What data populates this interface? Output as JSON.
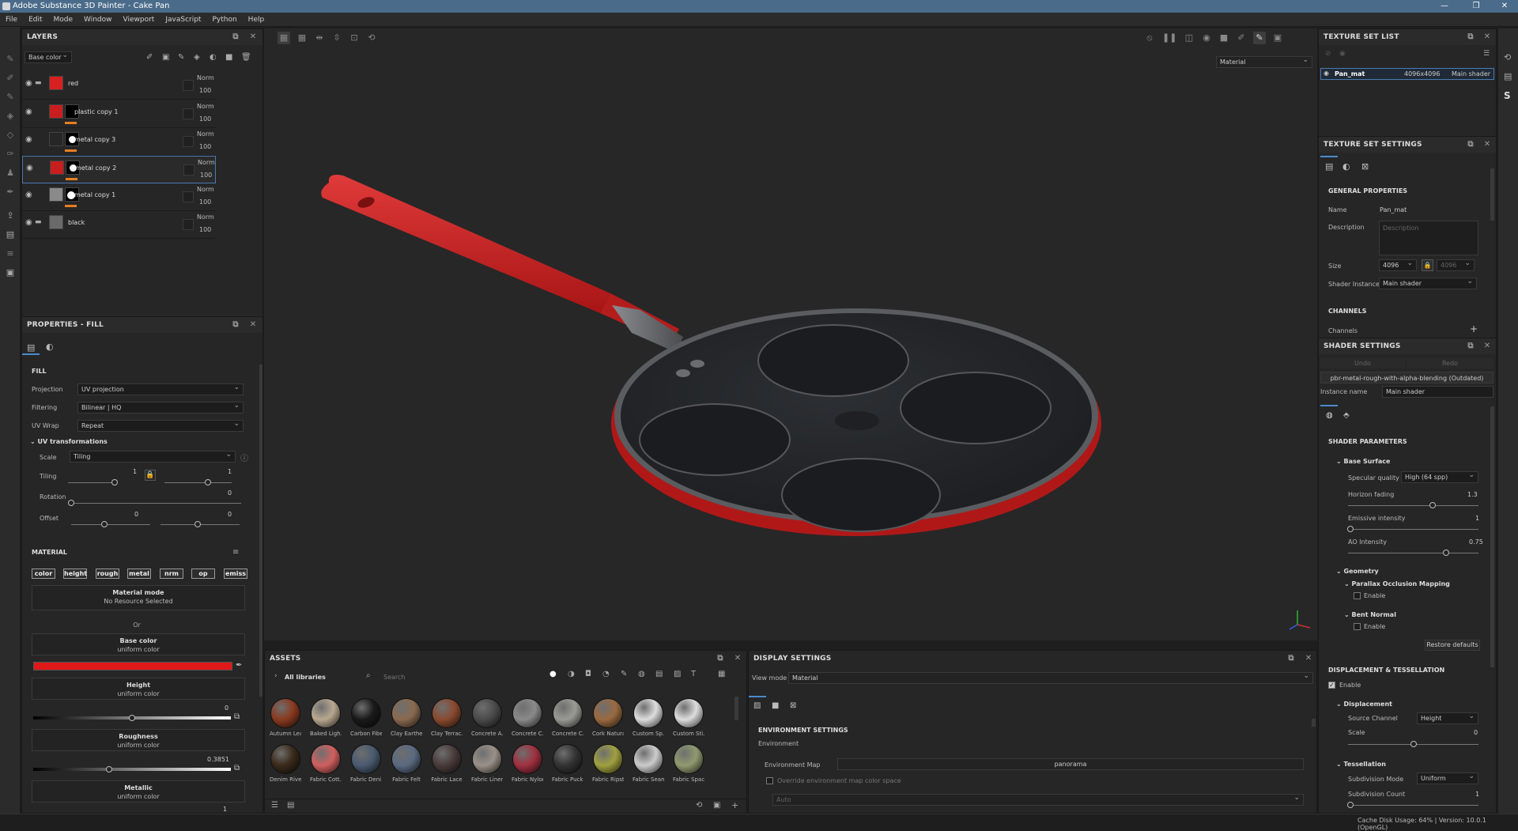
{
  "window": {
    "title": "Adobe Substance 3D Painter - Cake Pan"
  },
  "menu": [
    "File",
    "Edit",
    "Mode",
    "Window",
    "Viewport",
    "JavaScript",
    "Python",
    "Help"
  ],
  "layers": {
    "title": "LAYERS",
    "channel": "Base color",
    "items": [
      {
        "name": "red",
        "blend": "Norm",
        "opacity": "100"
      },
      {
        "name": "plastic copy 1",
        "blend": "Norm",
        "opacity": "100"
      },
      {
        "name": "metal copy 3",
        "blend": "Norm",
        "opacity": "100"
      },
      {
        "name": "metal copy 2",
        "blend": "Norm",
        "opacity": "100"
      },
      {
        "name": "metal copy 1",
        "blend": "Norm",
        "opacity": "100"
      },
      {
        "name": "black",
        "blend": "Norm",
        "opacity": "100"
      }
    ]
  },
  "props": {
    "title": "PROPERTIES - FILL",
    "fill_label": "FILL",
    "projection_label": "Projection",
    "projection": "UV projection",
    "filtering_label": "Filtering",
    "filtering": "Bilinear | HQ",
    "uvwrap_label": "UV Wrap",
    "uvwrap": "Repeat",
    "uvtrans": "UV transformations",
    "scale_label": "Scale",
    "scale": "Tiling",
    "tiling_label": "Tiling",
    "tiling_a": "1",
    "tiling_b": "1",
    "rotation_label": "Rotation",
    "rotation": "0",
    "offset_label": "Offset",
    "offset_a": "0",
    "offset_b": "0",
    "material_label": "MATERIAL",
    "chips": [
      "color",
      "height",
      "rough",
      "metal",
      "nrm",
      "op",
      "emiss"
    ],
    "matmode_title": "Material mode",
    "matmode_sub": "No Resource Selected",
    "or": "Or",
    "basecolor_title": "Base color",
    "basecolor_sub": "uniform color",
    "basecolor_hex": "#e01818",
    "height_title": "Height",
    "height_sub": "uniform color",
    "height_val": "0",
    "height_level": 0.5,
    "rough_title": "Roughness",
    "rough_sub": "uniform color",
    "rough_val": "0.3851",
    "rough_level": 0.3851,
    "metal_title": "Metallic",
    "metal_sub": "uniform color",
    "metal_val": "1"
  },
  "viewport": {
    "mode": "Material"
  },
  "assets": {
    "title": "ASSETS",
    "library": "All libraries",
    "search_placeholder": "Search",
    "row1": [
      {
        "name": "Autumn Leaf",
        "color": "#8a3a20"
      },
      {
        "name": "Baked Ligh...",
        "color": "#b8a890"
      },
      {
        "name": "Carbon Fiber",
        "color": "#1a1a1a"
      },
      {
        "name": "Clay Earthe...",
        "color": "#8a6a50"
      },
      {
        "name": "Clay Terrac...",
        "color": "#8a4a30"
      },
      {
        "name": "Concrete A...",
        "color": "#4a4a4a"
      },
      {
        "name": "Concrete C...",
        "color": "#8a8a8a"
      },
      {
        "name": "Concrete C...",
        "color": "#9a9a95"
      },
      {
        "name": "Cork Natural",
        "color": "#9a6a40"
      },
      {
        "name": "Custom Sp...",
        "color": "#dddddd"
      },
      {
        "name": "Custom Sti...",
        "color": "#dddddd"
      }
    ],
    "row2": [
      {
        "name": "Denim Rivet",
        "color": "#3a2a1a"
      },
      {
        "name": "Fabric Cott...",
        "color": "#d06060"
      },
      {
        "name": "Fabric Deni...",
        "color": "#4a5a70"
      },
      {
        "name": "Fabric Felt",
        "color": "#5a6a80"
      },
      {
        "name": "Fabric Lace",
        "color": "#4a3a3a"
      },
      {
        "name": "Fabric Linen",
        "color": "#9a9088"
      },
      {
        "name": "Fabric Nylon",
        "color": "#a03040"
      },
      {
        "name": "Fabric Puck...",
        "color": "#333333"
      },
      {
        "name": "Fabric Ripst...",
        "color": "#a0a040"
      },
      {
        "name": "Fabric Seam",
        "color": "#cccccc"
      },
      {
        "name": "Fabric Spac...",
        "color": "#909a70"
      }
    ]
  },
  "display": {
    "title": "DISPLAY SETTINGS",
    "viewmode_label": "View mode",
    "viewmode": "Material",
    "env_title": "ENVIRONMENT SETTINGS",
    "env_label": "Environment",
    "envmap_label": "Environment Map",
    "envmap": "panorama",
    "override_label": "Override environment map color space",
    "auto": "Auto"
  },
  "textureset": {
    "title": "TEXTURE SET LIST",
    "item_name": "Pan_mat",
    "item_size": "4096x4096",
    "item_shader": "Main shader"
  },
  "tss": {
    "title": "TEXTURE SET SETTINGS",
    "general": "GENERAL PROPERTIES",
    "name_label": "Name",
    "name": "Pan_mat",
    "desc_label": "Description",
    "desc_placeholder": "Description",
    "size_label": "Size",
    "size_a": "4096",
    "size_b": "4096",
    "shader_label": "Shader Instance",
    "shader": "Main shader",
    "channels_title": "CHANNELS",
    "channels_label": "Channels"
  },
  "shader": {
    "title": "SHADER SETTINGS",
    "undo": "Undo",
    "redo": "Redo",
    "preset": "pbr-metal-rough-with-alpha-blending (Outdated)",
    "instname_label": "Instance name",
    "instname": "Main shader",
    "params_title": "SHADER PARAMETERS",
    "base_surface": "Base Surface",
    "specq_label": "Specular quality",
    "specq": "High (64 spp)",
    "horizon_label": "Horizon fading",
    "horizon": "1.3",
    "horizon_level": 0.65,
    "emissive_label": "Emissive intensity",
    "emissive": "1",
    "emissive_level": 0.02,
    "ao_label": "AO Intensity",
    "ao": "0.75",
    "ao_level": 0.75,
    "geometry": "Geometry",
    "pom": "Parallax Occlusion Mapping",
    "enable": "Enable",
    "bent": "Bent Normal",
    "restore": "Restore defaults",
    "disp_title": "DISPLACEMENT & TESSELLATION",
    "displacement": "Displacement",
    "source_label": "Source Channel",
    "source": "Height",
    "scale_label": "Scale",
    "scale": "0",
    "scale_level": 0.5,
    "tess": "Tessellation",
    "submode_label": "Subdivision Mode",
    "submode": "Uniform",
    "subcount_label": "Subdivision Count",
    "subcount": "1"
  },
  "status": {
    "text": "Cache Disk Usage:   64% | Version: 10.0.1 (OpenGL)"
  }
}
